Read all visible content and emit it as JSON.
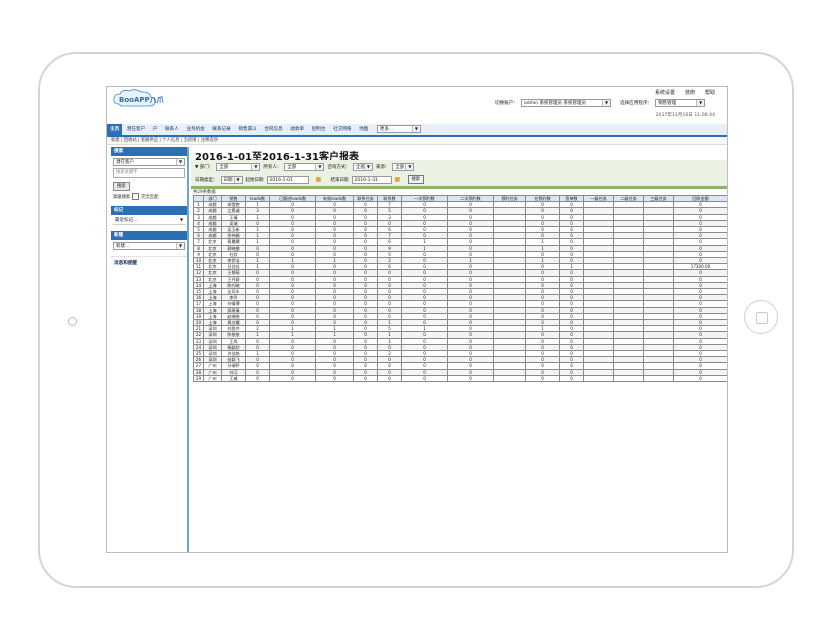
{
  "app": {
    "logo_text": "BooAPP八爪"
  },
  "top_links": [
    "系统设置",
    "技術",
    "帮助"
  ],
  "account": {
    "label": "切换账户：",
    "value": "admin 系统管理员 系统管理员",
    "program_label": "选择应用程序：",
    "program_value": "销售管理"
  },
  "datetime": "2017年11月10日 11:08:44",
  "nav": {
    "items": [
      "主页",
      "潜在客户",
      "户",
      "联系人",
      "业务机会",
      "联系记录",
      "销售漏斗",
      "合同信息",
      "收款单",
      "控制台",
      "社交网络",
      "地图"
    ],
    "more": "更多..."
  },
  "breadcrumb": "新建 | 回收站 | 客服供应 | 个人信息 | 无权限 | 注释选项",
  "sidebar": {
    "search_title": "搜索",
    "search_select": "潜在客户",
    "search_placeholder": "搜索关键字",
    "search_button": "搜索",
    "advanced": "高级搜索",
    "exact": "完全匹配",
    "tag_title": "标记",
    "tag_select": "最近标记...",
    "new_title": "新建",
    "new_select": "新建...",
    "msg_title": "消息和提醒"
  },
  "report": {
    "title": "2016-1-01至2016-1-31客户报表",
    "dept_label": "▼ 部门：",
    "dept_value": "全部",
    "owner_label": "所有人：",
    "owner_value": "全部",
    "consult_label": "咨询方式：",
    "consult_value": "全部",
    "source_label": "来源：",
    "source_value": "全部",
    "datetype_label": "日期类型：",
    "datetype_value": "日期",
    "start_label": "起始日期",
    "start_value": "2016-1-01",
    "end_label": "结束日期",
    "end_value": "2016-1-31",
    "search_button": "搜索",
    "count": "共29条数据"
  },
  "table": {
    "headers": [
      "",
      "部门",
      "销售",
      "leads数",
      "已跟进leads数",
      "有效leads数",
      "联系任务",
      "联系数",
      "一次预约数",
      "二次预约数",
      "预约任务",
      "在预约数",
      "签单数",
      "一级任务",
      "二级任务",
      "三级任务",
      "回款金额"
    ],
    "rows": [
      [
        "1",
        "成都",
        "胡雪艳",
        "1",
        "0",
        "0",
        "0",
        "7",
        "0",
        "0",
        "",
        "0",
        "0",
        "",
        "",
        "",
        "0"
      ],
      [
        "2",
        "成都",
        "江恩诚",
        "3",
        "0",
        "0",
        "0",
        "5",
        "0",
        "0",
        "",
        "0",
        "0",
        "",
        "",
        "",
        "0"
      ],
      [
        "3",
        "成都",
        "王倩",
        "1",
        "0",
        "0",
        "0",
        "3",
        "0",
        "0",
        "",
        "0",
        "0",
        "",
        "",
        "",
        "0"
      ],
      [
        "4",
        "成都",
        "吴瑞",
        "0",
        "0",
        "0",
        "0",
        "0",
        "0",
        "0",
        "",
        "0",
        "0",
        "",
        "",
        "",
        "0"
      ],
      [
        "5",
        "成都",
        "吴玉新",
        "1",
        "0",
        "0",
        "0",
        "6",
        "0",
        "0",
        "",
        "0",
        "0",
        "",
        "",
        "",
        "0"
      ],
      [
        "6",
        "成都",
        "徐伟娟",
        "1",
        "0",
        "0",
        "0",
        "7",
        "0",
        "0",
        "",
        "0",
        "0",
        "",
        "",
        "",
        "0"
      ],
      [
        "7",
        "北京",
        "蔡晨曦",
        "1",
        "0",
        "0",
        "0",
        "6",
        "1",
        "0",
        "",
        "1",
        "0",
        "",
        "",
        "",
        "0"
      ],
      [
        "8",
        "北京",
        "郭晓娜",
        "0",
        "0",
        "0",
        "0",
        "9",
        "1",
        "0",
        "",
        "1",
        "0",
        "",
        "",
        "",
        "0"
      ],
      [
        "9",
        "北京",
        "杜欣",
        "0",
        "0",
        "0",
        "0",
        "0",
        "0",
        "0",
        "",
        "0",
        "0",
        "",
        "",
        "",
        "0"
      ],
      [
        "10",
        "北京",
        "李伊洁",
        "1",
        "1",
        "1",
        "0",
        "2",
        "0",
        "1",
        "",
        "1",
        "0",
        "",
        "",
        "",
        "0"
      ],
      [
        "11",
        "北京",
        "吕佳佳",
        "1",
        "0",
        "0",
        "0",
        "6",
        "0",
        "0",
        "",
        "0",
        "1",
        "",
        "",
        "",
        "17300.00"
      ],
      [
        "12",
        "北京",
        "王郁萌",
        "0",
        "0",
        "0",
        "0",
        "0",
        "0",
        "0",
        "",
        "0",
        "0",
        "",
        "",
        "",
        "0"
      ],
      [
        "13",
        "北京",
        "王丹赛",
        "0",
        "0",
        "0",
        "0",
        "0",
        "0",
        "0",
        "",
        "0",
        "0",
        "",
        "",
        "",
        "0"
      ],
      [
        "14",
        "上海",
        "陈巧晓",
        "0",
        "0",
        "0",
        "0",
        "0",
        "0",
        "0",
        "",
        "0",
        "0",
        "",
        "",
        "",
        "0"
      ],
      [
        "15",
        "上海",
        "丛司丰",
        "0",
        "0",
        "0",
        "0",
        "0",
        "0",
        "0",
        "",
        "0",
        "0",
        "",
        "",
        "",
        "0"
      ],
      [
        "16",
        "上海",
        "李丹",
        "0",
        "0",
        "0",
        "0",
        "0",
        "0",
        "0",
        "",
        "0",
        "0",
        "",
        "",
        "",
        "0"
      ],
      [
        "17",
        "上海",
        "刘倩博",
        "0",
        "0",
        "0",
        "0",
        "0",
        "0",
        "0",
        "",
        "0",
        "0",
        "",
        "",
        "",
        "0"
      ],
      [
        "18",
        "上海",
        "邱燕倩",
        "0",
        "0",
        "0",
        "0",
        "0",
        "0",
        "0",
        "",
        "0",
        "0",
        "",
        "",
        "",
        "0"
      ],
      [
        "19",
        "上海",
        "赵晓晓",
        "0",
        "0",
        "0",
        "0",
        "0",
        "0",
        "0",
        "",
        "0",
        "0",
        "",
        "",
        "",
        "0"
      ],
      [
        "20",
        "上海",
        "周文耀",
        "0",
        "0",
        "0",
        "0",
        "1",
        "0",
        "0",
        "",
        "0",
        "0",
        "",
        "",
        "",
        "0"
      ],
      [
        "21",
        "深圳",
        "刘思齐",
        "2",
        "1",
        "1",
        "0",
        "5",
        "1",
        "0",
        "",
        "1",
        "0",
        "",
        "",
        "",
        "0"
      ],
      [
        "22",
        "深圳",
        "陈依依",
        "1",
        "1",
        "1",
        "0",
        "1",
        "0",
        "0",
        "",
        "0",
        "0",
        "",
        "",
        "",
        "0"
      ],
      [
        "23",
        "深圳",
        "王岚",
        "0",
        "0",
        "0",
        "0",
        "1",
        "0",
        "0",
        "",
        "0",
        "0",
        "",
        "",
        "",
        "0"
      ],
      [
        "24",
        "深圳",
        "杨颖欣",
        "0",
        "0",
        "0",
        "0",
        "0",
        "0",
        "0",
        "",
        "0",
        "0",
        "",
        "",
        "",
        "0"
      ],
      [
        "25",
        "深圳",
        "许佳皓",
        "1",
        "0",
        "0",
        "0",
        "2",
        "0",
        "0",
        "",
        "0",
        "0",
        "",
        "",
        "",
        "0"
      ],
      [
        "26",
        "深圳",
        "张颖飞",
        "0",
        "0",
        "0",
        "0",
        "0",
        "0",
        "0",
        "",
        "0",
        "0",
        "",
        "",
        "",
        "0"
      ],
      [
        "27",
        "广州",
        "孙瑞怀",
        "0",
        "0",
        "0",
        "0",
        "0",
        "0",
        "0",
        "",
        "0",
        "0",
        "",
        "",
        "",
        "0"
      ],
      [
        "28",
        "广州",
        "刘习",
        "0",
        "0",
        "0",
        "0",
        "0",
        "0",
        "0",
        "",
        "0",
        "0",
        "",
        "",
        "",
        "0"
      ],
      [
        "29",
        "广州",
        "王威",
        "0",
        "0",
        "0",
        "0",
        "0",
        "0",
        "0",
        "",
        "0",
        "0",
        "",
        "",
        "",
        "0"
      ]
    ]
  },
  "colors": {
    "nav_active": "#2b6fb5",
    "filter_bg": "#e9f2e3",
    "header_cell": "#d9e6f3"
  }
}
